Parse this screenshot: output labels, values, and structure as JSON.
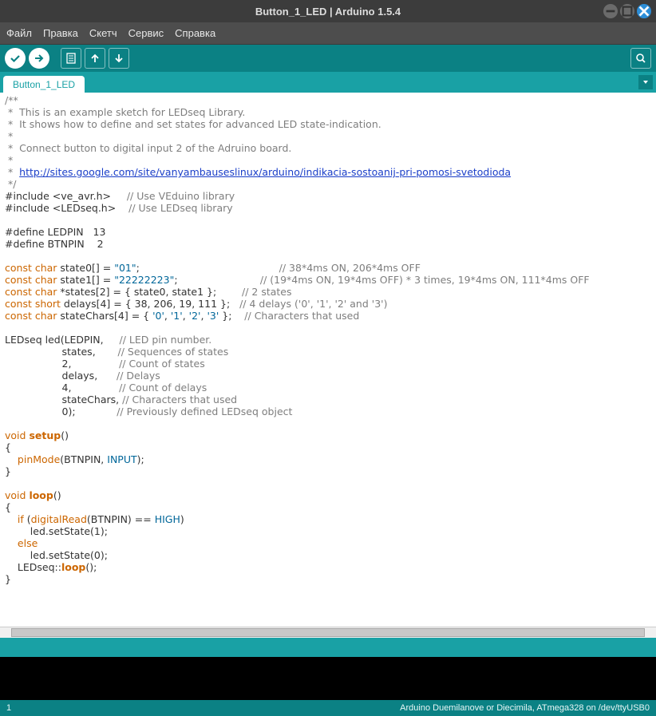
{
  "window": {
    "title": "Button_1_LED | Arduino 1.5.4"
  },
  "menu": {
    "file": "Файл",
    "edit": "Правка",
    "sketch": "Скетч",
    "service": "Сервис",
    "help": "Справка"
  },
  "tabs": {
    "active": "Button_1_LED"
  },
  "footer": {
    "line": "1",
    "board": "Arduino Duemilanove or Diecimila, ATmega328 on /dev/ttyUSB0"
  },
  "code": {
    "c_open": "/**",
    "c1": " *  This is an example sketch for LEDseq Library.",
    "c2": " *  It shows how to define and set states for advanced LED state-indication.",
    "c3": " *",
    "c4": " *  Connect button to digital input 2 of the Adruino board.",
    "c5": " *",
    "c6_pre": " *  ",
    "c6_link": "http://sites.google.com/site/vanyambauseslinux/arduino/indikacia-sostoanij-pri-pomosi-svetodioda",
    "c_close": " */",
    "inc1_a": "#include <ve_avr.h>     ",
    "inc1_b": "// Use VEduino library",
    "inc2_a": "#include <LEDseq.h>    ",
    "inc2_b": "// Use LEDseq library",
    "def1": "#define LEDPIN   13",
    "def2": "#define BTNPIN    2",
    "s0_a": "const char",
    "s0_b": " state0[] = ",
    "s0_c": "\"01\"",
    "s0_d": ";                                            ",
    "s0_e": "// 38*4ms ON, 206*4ms OFF",
    "s1_a": "const char",
    "s1_b": " state1[] = ",
    "s1_c": "\"22222223\"",
    "s1_d": ";                          ",
    "s1_e": "// (19*4ms ON, 19*4ms OFF) * 3 times, 19*4ms ON, 111*4ms OFF",
    "s2_a": "const char",
    "s2_b": " *states[2] = { state0, state1 };        ",
    "s2_c": "// 2 states",
    "s3_a": "const short",
    "s3_b": " delays[4] = { 38, 206, 19, 111 };   ",
    "s3_c": "// 4 delays ('0', '1', '2' and '3')",
    "s4_a": "const char",
    "s4_b": " stateChars[4] = { ",
    "s4_c": "'0'",
    "s4_d": ", ",
    "s4_e": "'1'",
    "s4_f": ", ",
    "s4_g": "'2'",
    "s4_h": ", ",
    "s4_i": "'3'",
    "s4_j": " };    ",
    "s4_k": "// Characters that used",
    "l1_a": "LEDseq led(LEDPIN,     ",
    "l1_b": "// LED pin number.",
    "l2_a": "                  states,       ",
    "l2_b": "// Sequences of states",
    "l3_a": "                  2,               ",
    "l3_b": "// Count of states",
    "l4_a": "                  delays,      ",
    "l4_b": "// Delays",
    "l5_a": "                  4,               ",
    "l5_b": "// Count of delays",
    "l6_a": "                  stateChars, ",
    "l6_b": "// Characters that used",
    "l7_a": "                  0);             ",
    "l7_b": "// Previously defined LEDseq object",
    "setup_a": "void",
    "setup_b": " ",
    "setup_c": "setup",
    "setup_d": "()",
    "ob": "{",
    "pin_a": "    ",
    "pin_b": "pinMode",
    "pin_c": "(BTNPIN, ",
    "pin_d": "INPUT",
    "pin_e": ");",
    "cb": "}",
    "loop_a": "void",
    "loop_b": " ",
    "loop_c": "loop",
    "loop_d": "()",
    "if_a": "    ",
    "if_b": "if",
    "if_c": " (",
    "if_d": "digitalRead",
    "if_e": "(BTNPIN) == ",
    "if_f": "HIGH",
    "if_g": ")",
    "set1": "        led.setState(1);",
    "else_a": "    ",
    "else_b": "else",
    "set0": "        led.setState(0);",
    "lseq_a": "    LEDseq::",
    "lseq_b": "loop",
    "lseq_c": "();"
  }
}
